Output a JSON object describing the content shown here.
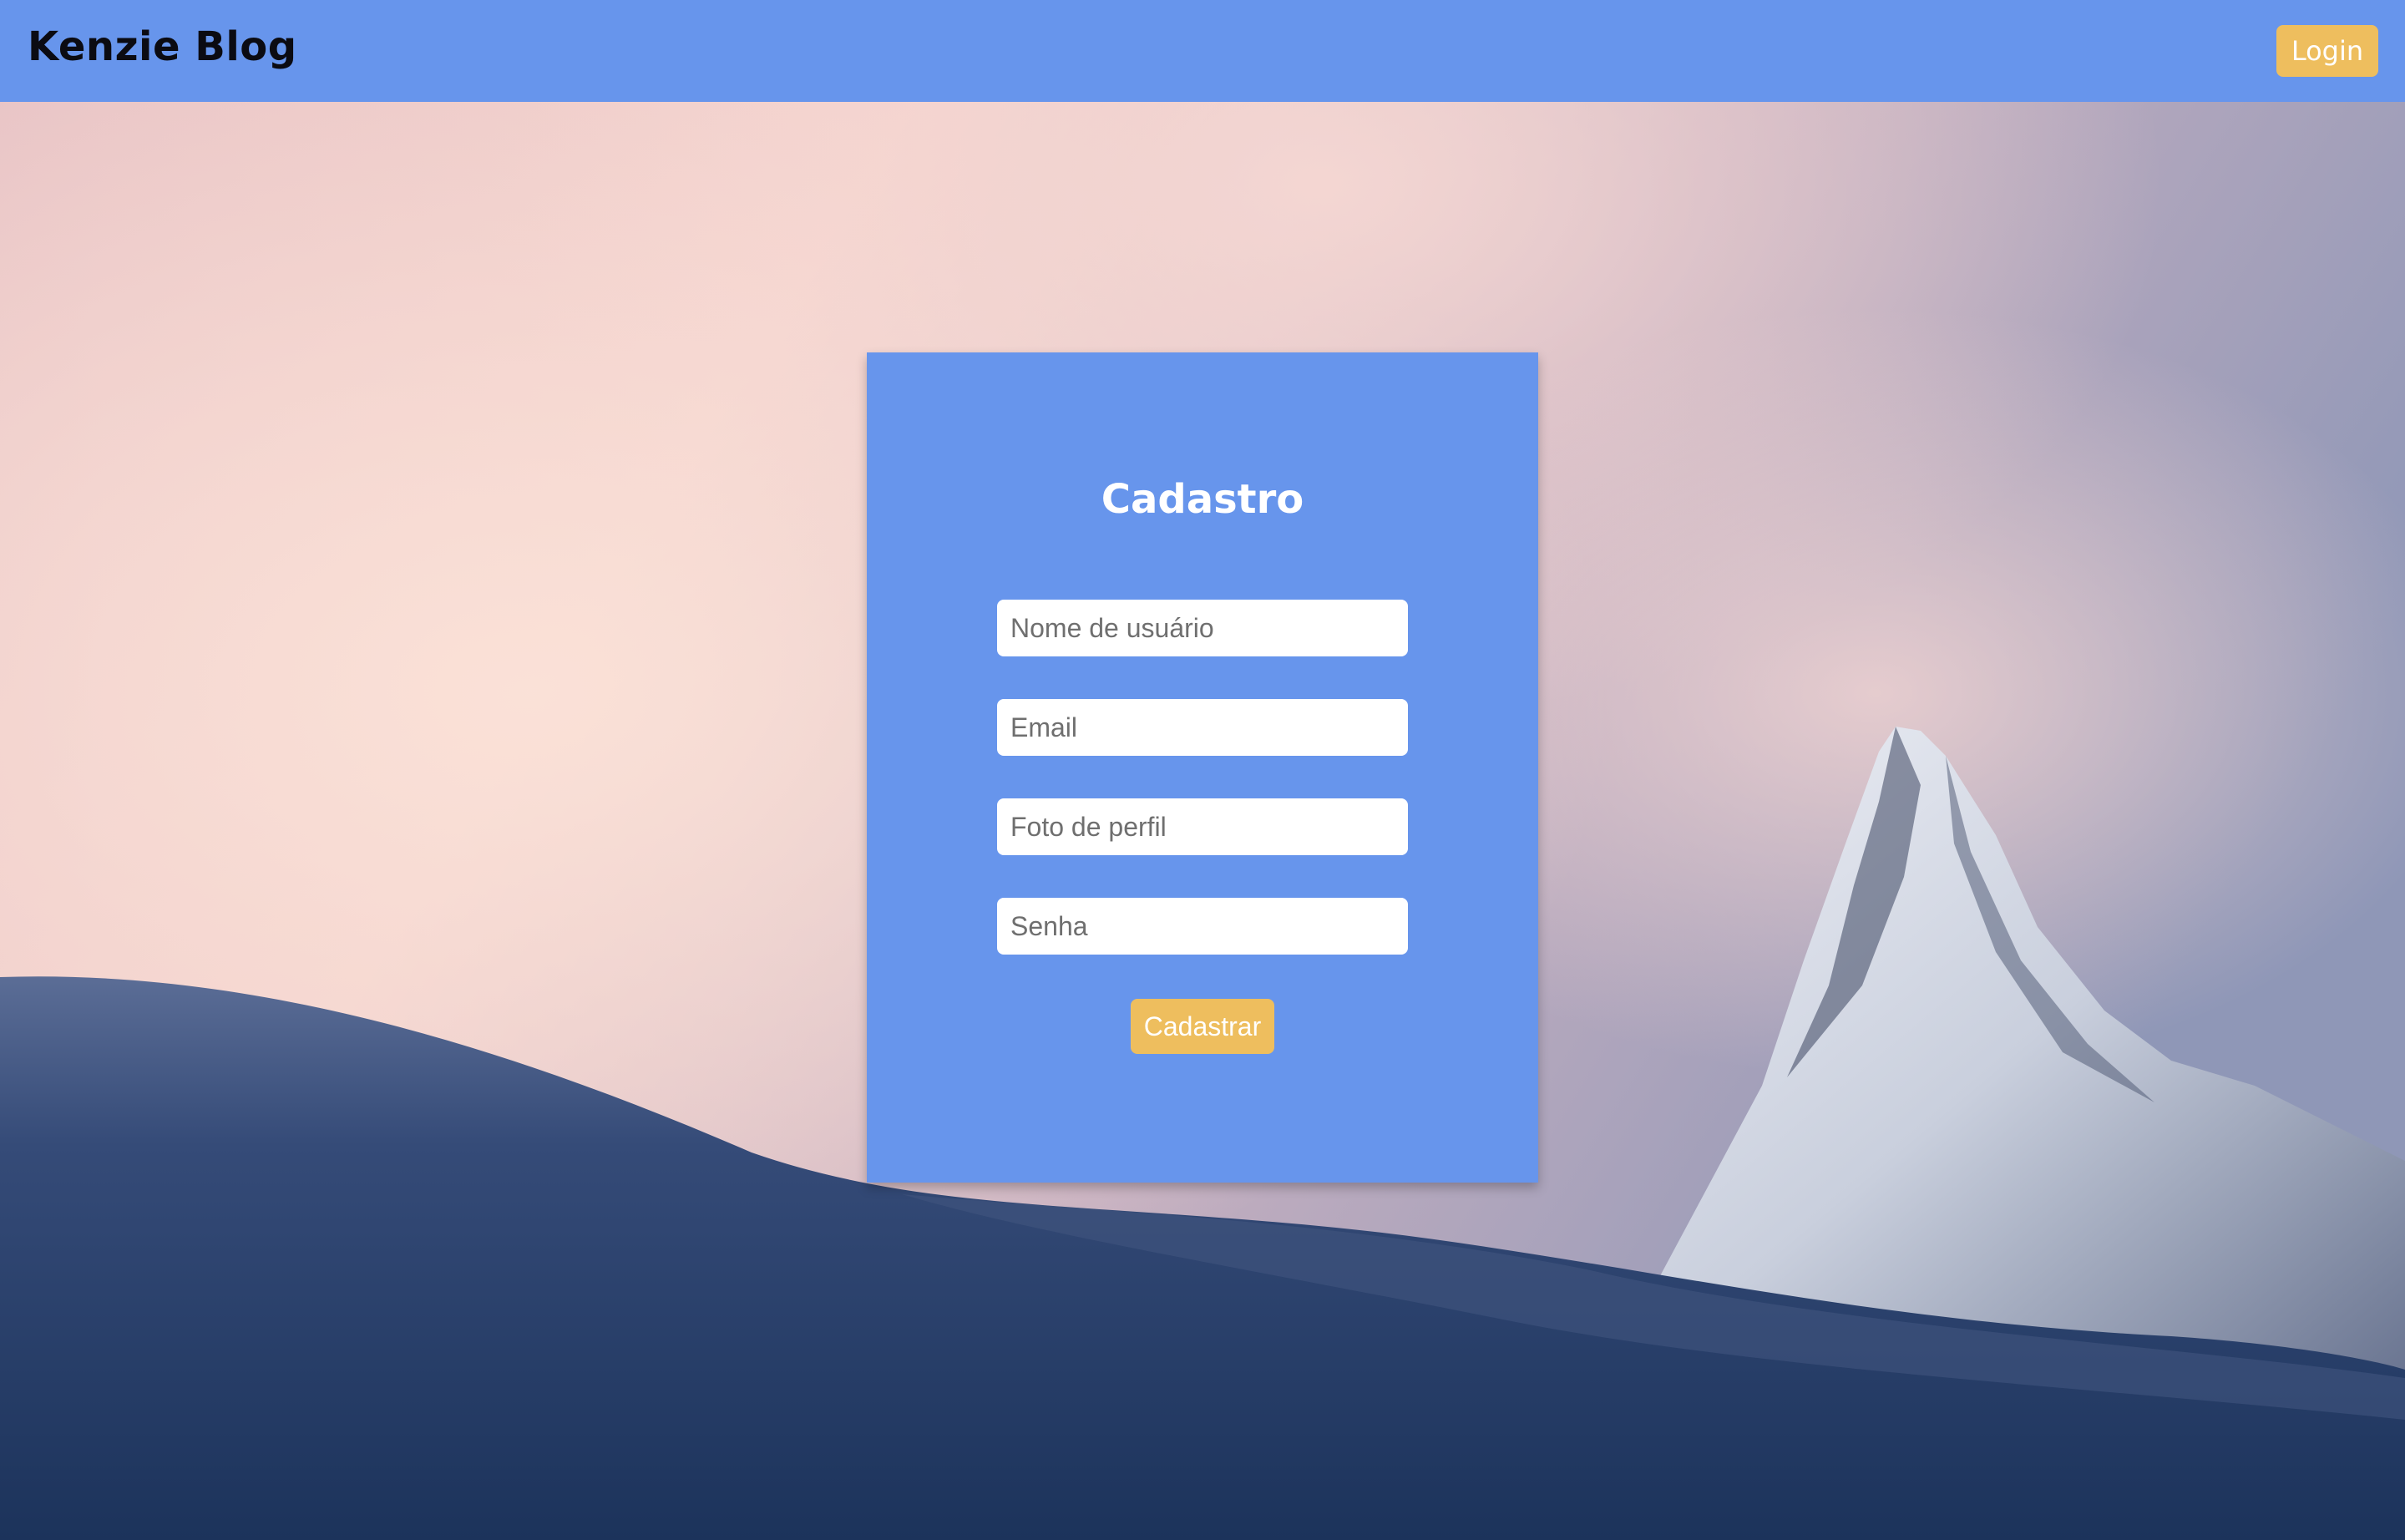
{
  "navbar": {
    "brand": "Kenzie Blog",
    "login_label": "Login"
  },
  "form": {
    "title": "Cadastro",
    "fields": [
      {
        "placeholder": "Nome de usuário",
        "value": ""
      },
      {
        "placeholder": "Email",
        "value": ""
      },
      {
        "placeholder": "Foto de perfil",
        "value": ""
      },
      {
        "placeholder": "Senha",
        "value": ""
      }
    ],
    "submit_label": "Cadastrar"
  },
  "background": {
    "subject": "snow-mountain-sunset"
  },
  "colors": {
    "primary": "#6795ec",
    "accent": "#eebe5e",
    "brand_text": "#0b0b12",
    "white": "#ffffff"
  }
}
